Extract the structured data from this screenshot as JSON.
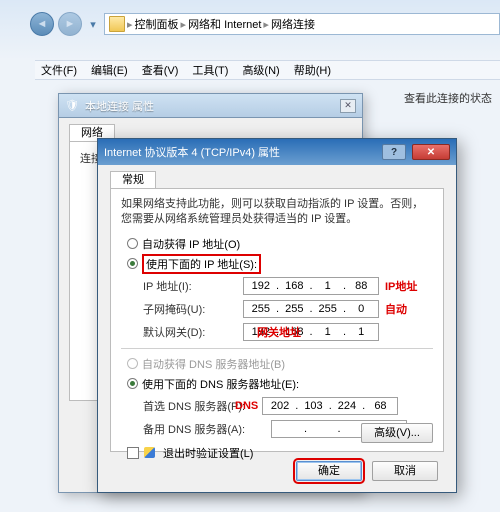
{
  "nav": {
    "crumb1": "控制面板",
    "crumb2": "网络和 Internet",
    "crumb3": "网络连接"
  },
  "menu": {
    "file": "文件(F)",
    "edit": "编辑(E)",
    "view": "查看(V)",
    "tools": "工具(T)",
    "advanced": "高级(N)",
    "help": "帮助(H)"
  },
  "info_label": "查看此连接的状态",
  "dlg1": {
    "title": "本地连接 属性",
    "tab": "网络",
    "section": "连接时使用："
  },
  "dlg2": {
    "title": "Internet 协议版本 4 (TCP/IPv4) 属性",
    "tab": "常规",
    "description": "如果网络支持此功能，则可以获取自动指派的 IP 设置。否则，您需要从网络系统管理员处获得适当的 IP 设置。",
    "radio_auto_ip": "自动获得 IP 地址(O)",
    "radio_manual_ip": "使用下面的 IP 地址(S):",
    "ip_label": "IP 地址(I):",
    "ip_value": {
      "o1": "192",
      "o2": "168",
      "o3": "1",
      "o4": "88"
    },
    "subnet_label": "子网掩码(U):",
    "subnet_value": {
      "o1": "255",
      "o2": "255",
      "o3": "255",
      "o4": "0"
    },
    "gateway_label": "默认网关(D):",
    "gateway_value": {
      "o1": "192",
      "o2": "168",
      "o3": "1",
      "o4": "1"
    },
    "radio_auto_dns": "自动获得 DNS 服务器地址(B)",
    "radio_manual_dns": "使用下面的 DNS 服务器地址(E):",
    "dns1_label": "首选 DNS 服务器(P):",
    "dns1_value": {
      "o1": "202",
      "o2": "103",
      "o3": "224",
      "o4": "68"
    },
    "dns2_label": "备用 DNS 服务器(A):",
    "dns2_value": {
      "o1": "",
      "o2": "",
      "o3": "",
      "o4": ""
    },
    "validate_checkbox": "退出时验证设置(L)",
    "advanced_btn": "高级(V)...",
    "ok_btn": "确定",
    "cancel_btn": "取消",
    "annot_ip": "IP地址",
    "annot_auto": "自动",
    "annot_gateway": "网关地址",
    "annot_dns": "DNS"
  }
}
